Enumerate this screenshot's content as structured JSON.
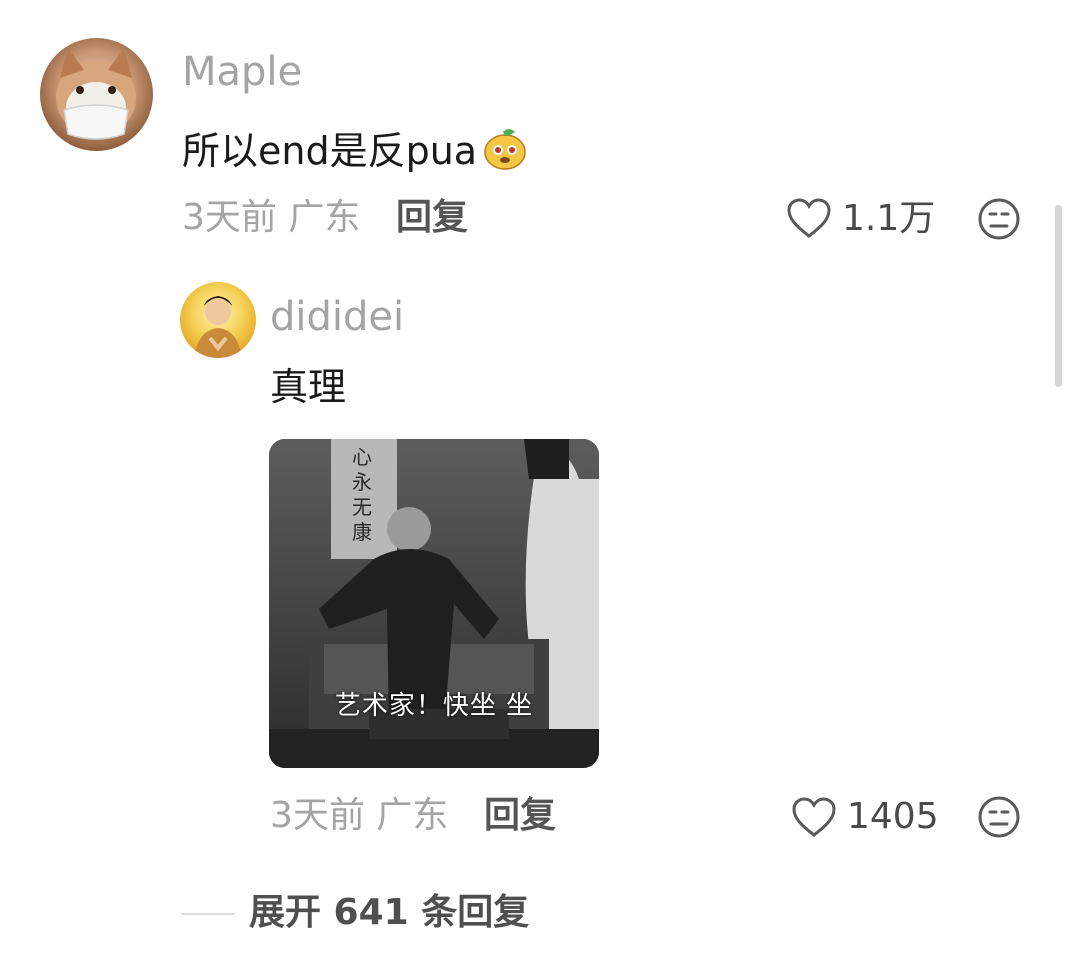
{
  "comment": {
    "username": "Maple",
    "text": "所以end是反pua",
    "emoji": "mango-dog-emoji",
    "time": "3天前",
    "location": "广东",
    "reply_label": "回复",
    "likes": "1.1万",
    "avatar": "shiba-dog-avatar"
  },
  "reply": {
    "username": "dididei",
    "text": "真理",
    "image_caption": "艺术家！快坐 坐",
    "image_sign_text": "心永无康",
    "time": "3天前",
    "location": "广东",
    "reply_label": "回复",
    "likes": "1405",
    "avatar": "person-avatar"
  },
  "expand": {
    "label": "展开 641 条回复"
  },
  "icons": {
    "like": "heart-outline-icon",
    "react": "face-emoji-icon"
  },
  "colors": {
    "username": "#a4a4a4",
    "text": "#1a1a1a",
    "meta": "#a4a4a4",
    "reply_label": "#555555"
  }
}
